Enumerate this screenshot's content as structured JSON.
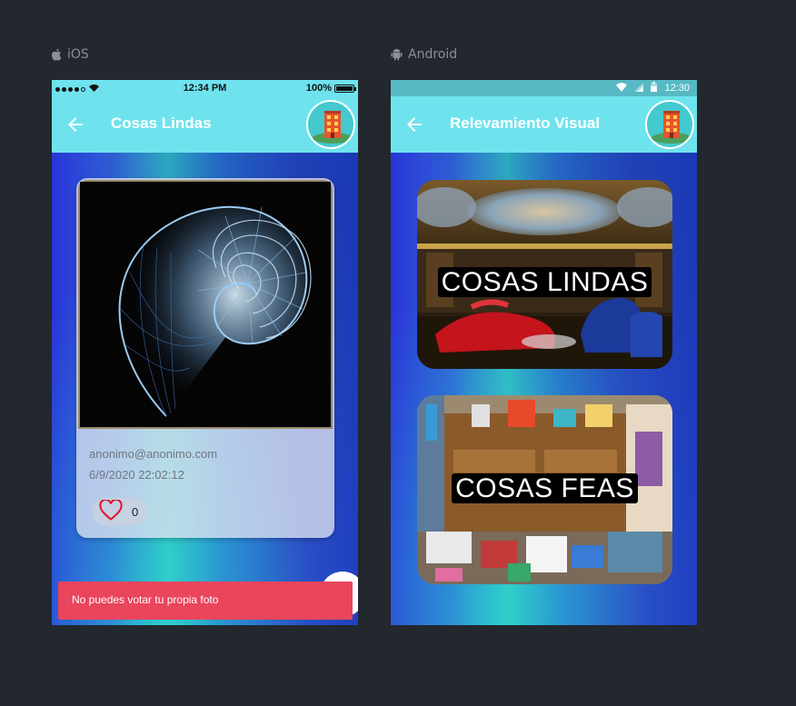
{
  "ios": {
    "platform_label": "iOS",
    "status": {
      "time": "12:34 PM",
      "battery": "100%"
    },
    "appbar": {
      "title": "Cosas Lindas"
    },
    "card": {
      "email": "anonimo@anonimo.com",
      "date": "6/9/2020 22:02:12",
      "likes": "0"
    },
    "toast": "No puedes votar tu propia foto"
  },
  "android": {
    "platform_label": "Android",
    "status": {
      "time": "12:30"
    },
    "appbar": {
      "title": "Relevamiento Visual"
    },
    "tiles": [
      {
        "label": "COSAS LINDAS"
      },
      {
        "label": "COSAS FEAS"
      }
    ]
  },
  "colors": {
    "appbar": "#6ee3ee",
    "toast": "#e9455c",
    "page_bg": "#23272e"
  },
  "icons": {
    "platform_ios": "apple-icon",
    "platform_android": "android-icon",
    "back": "arrow-left-icon",
    "avatar": "building-icon",
    "like": "heart-outline-icon"
  }
}
